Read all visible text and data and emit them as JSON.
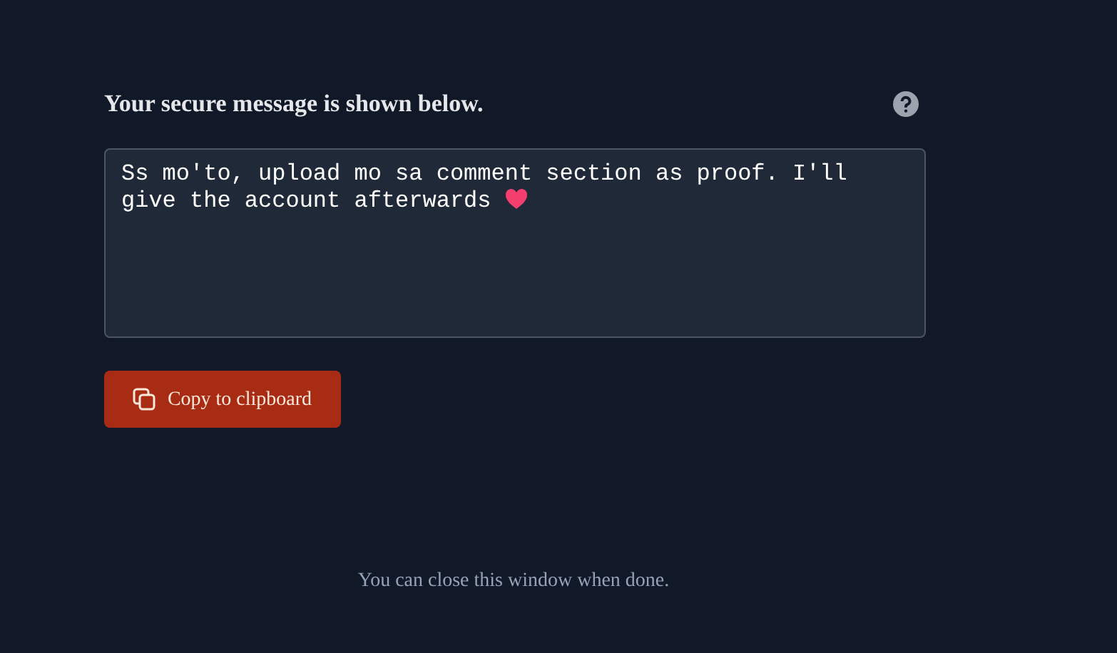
{
  "heading": "Your secure message is shown below.",
  "message": {
    "value": "Ss mo'to, upload mo sa comment section as proof. I'll give the account afterwards"
  },
  "copy_button": {
    "label": "Copy to clipboard"
  },
  "footer": "You can close this window when done."
}
